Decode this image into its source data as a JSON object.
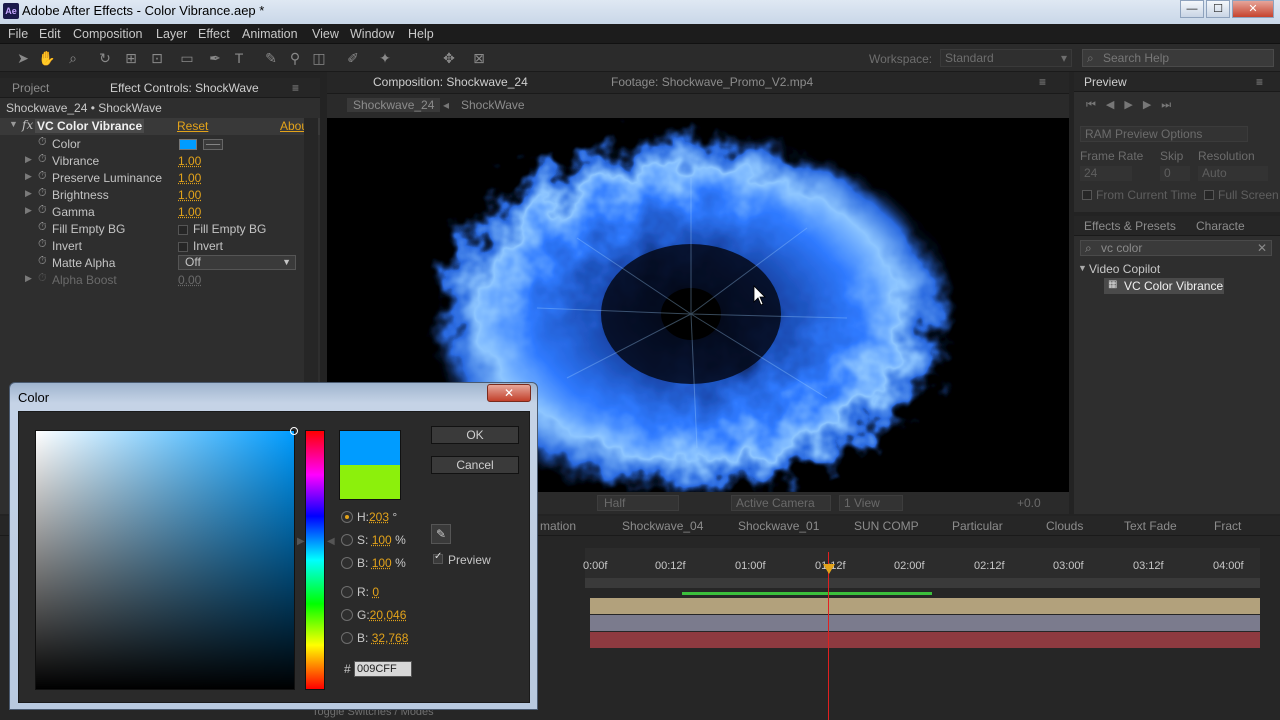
{
  "window": {
    "title": "Adobe After Effects - Color Vibrance.aep *",
    "app_icon": "Ae",
    "min": "—",
    "max": "☐",
    "close": "✕"
  },
  "menu": [
    "File",
    "Edit",
    "Composition",
    "Layer",
    "Effect",
    "Animation",
    "View",
    "Window",
    "Help"
  ],
  "toolbar": {
    "workspace_label": "Workspace:",
    "workspace_value": "Standard",
    "search_placeholder": "Search Help"
  },
  "left_panel": {
    "tabs": [
      "Project",
      "Effect Controls: ShockWave"
    ],
    "breadcrumb": "Shockwave_24 • ShockWave",
    "effect_name": "VC Color Vibrance",
    "reset": "Reset",
    "about": "Abou",
    "fx": "fx",
    "properties": [
      {
        "name": "Color",
        "value": ""
      },
      {
        "name": "Vibrance",
        "value": "1.00"
      },
      {
        "name": "Preserve Luminance",
        "value": "1.00"
      },
      {
        "name": "Brightness",
        "value": "1.00"
      },
      {
        "name": "Gamma",
        "value": "1.00"
      },
      {
        "name": "Fill Empty BG",
        "value": "Fill Empty BG"
      },
      {
        "name": "Invert",
        "value": "Invert"
      },
      {
        "name": "Matte Alpha",
        "value": "Off"
      },
      {
        "name": "Alpha Boost",
        "value": "0.00"
      }
    ]
  },
  "comp_panel": {
    "tabs": [
      "Composition: Shockwave_24",
      "Footage: Shockwave_Promo_V2.mp4"
    ],
    "crumbs": [
      "Shockwave_24",
      "ShockWave"
    ],
    "bottom": {
      "resolution": "Half",
      "camera": "Active Camera",
      "view": "1 View",
      "offset": "+0.0"
    }
  },
  "preview_panel": {
    "title": "Preview",
    "ram_options": "RAM Preview Options",
    "labels": [
      "Frame Rate",
      "Skip",
      "Resolution"
    ],
    "values": [
      "24",
      "0",
      "Auto"
    ],
    "checks": [
      "From Current Time",
      "Full Screen"
    ]
  },
  "effects_panel": {
    "tabs": [
      "Effects & Presets",
      "Characte"
    ],
    "search": "vc color",
    "category": "Video Copilot",
    "item": "VC Color Vibrance"
  },
  "timeline": {
    "tabs": [
      "mation",
      "Shockwave_04",
      "Shockwave_01",
      "SUN COMP",
      "Particular",
      "Clouds",
      "Text Fade",
      "Fract"
    ],
    "ruler": [
      "0:00f",
      "00:12f",
      "01:00f",
      "01:12f",
      "02:00f",
      "02:12f",
      "03:00f",
      "03:12f",
      "04:00f"
    ],
    "footer": "Toggle Switches / Modes"
  },
  "color_dialog": {
    "title": "Color",
    "ok": "OK",
    "cancel": "Cancel",
    "preview": "Preview",
    "h_label": "H:",
    "h_value": "203",
    "h_unit": "°",
    "s_label": "S:",
    "s_value": "100",
    "s_unit": "%",
    "b_label": "B:",
    "b_value": "100",
    "b_unit": "%",
    "r_label": "R:",
    "r_value": "0",
    "g_label": "G:",
    "g_value": "20,046",
    "b2_label": "B:",
    "b2_value": "32,768",
    "hash": "#",
    "hex": "009CFF",
    "new_color": "#009cff",
    "old_color": "#8cf00c",
    "close": "✕"
  }
}
